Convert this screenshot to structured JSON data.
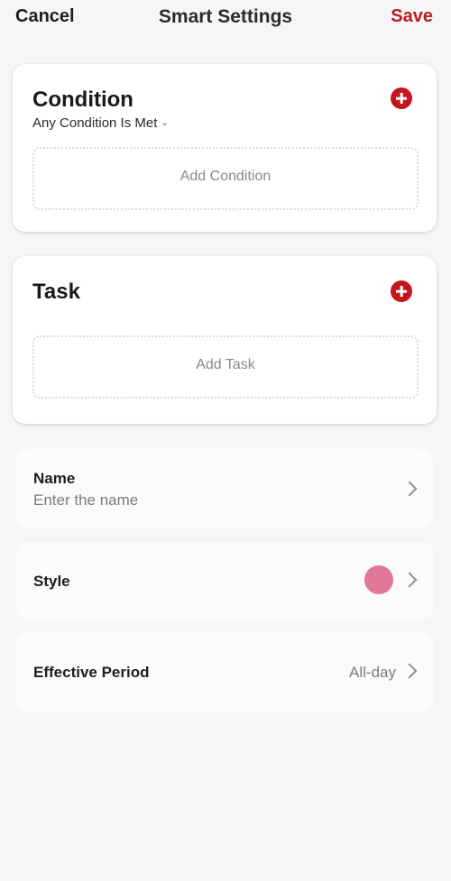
{
  "header": {
    "cancel_label": "Cancel",
    "title": "Smart Settings",
    "save_label": "Save"
  },
  "condition": {
    "title": "Condition",
    "match_mode": "Any Condition Is Met",
    "match_mode_icon": "chevron-down-icon",
    "add_icon": "plus-circle-icon",
    "placeholder": "Add Condition"
  },
  "task": {
    "title": "Task",
    "add_icon": "plus-circle-icon",
    "placeholder": "Add Task"
  },
  "settings": {
    "name": {
      "label": "Name",
      "placeholder": "Enter the name"
    },
    "style": {
      "label": "Style",
      "color": "#e07896"
    },
    "effective_period": {
      "label": "Effective Period",
      "value": "All-day"
    }
  },
  "colors": {
    "accent": "#c4151c",
    "save_text": "#b81c22",
    "background": "#f6f6f6"
  }
}
